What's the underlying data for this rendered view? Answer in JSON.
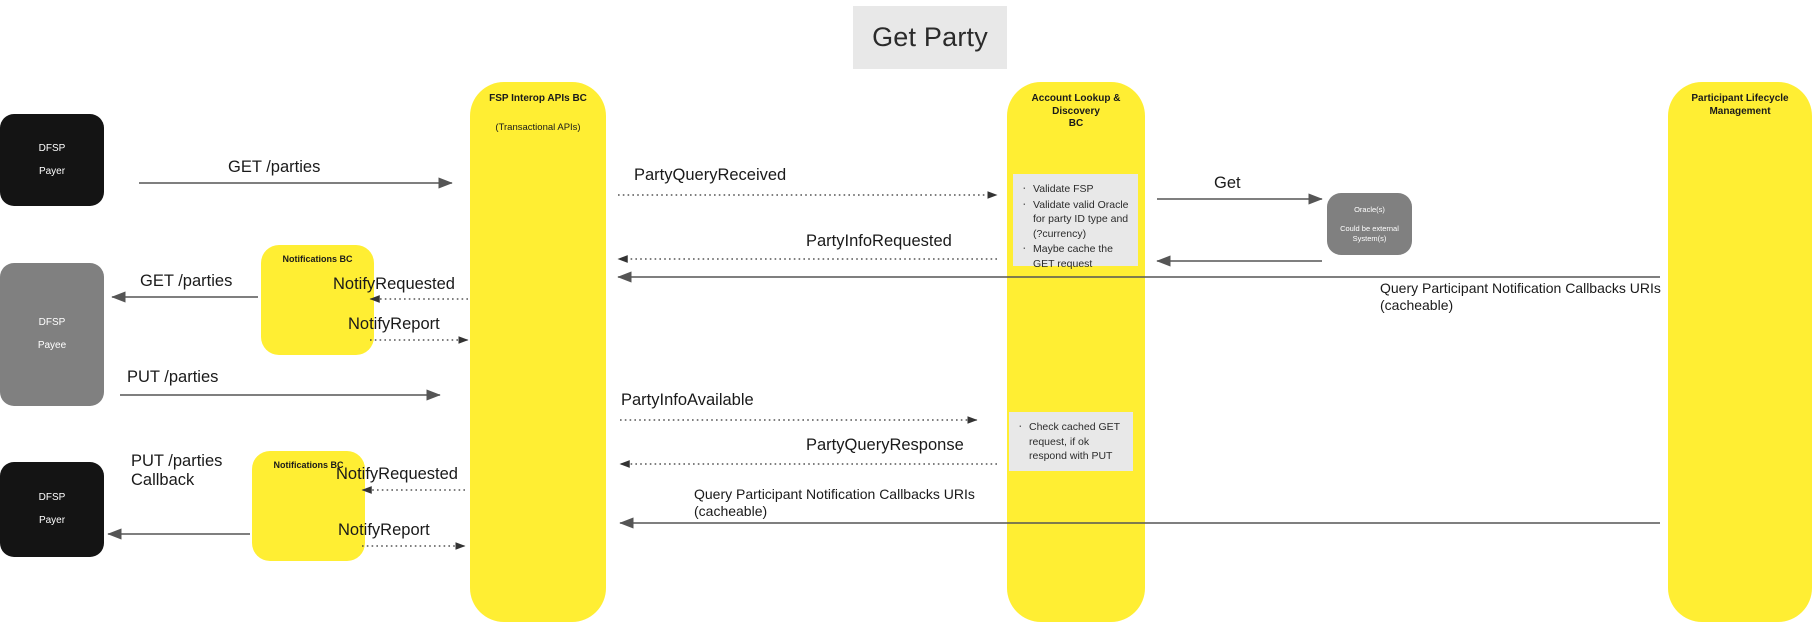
{
  "title": "Get Party",
  "colors": {
    "lifeline_yellow": "#ffee33",
    "note_gray": "#e8e8e8",
    "actor_black": "#141414",
    "actor_gray": "#808080",
    "oracle_gray": "#808080",
    "title_bg": "#e8e8e8"
  },
  "actors": [
    {
      "name": "dfsp-payer-top",
      "line1": "DFSP",
      "line2": "Payer"
    },
    {
      "name": "dfsp-payee",
      "line1": "DFSP",
      "line2": "Payee"
    },
    {
      "name": "dfsp-payer-bottom",
      "line1": "DFSP",
      "line2": "Payer"
    },
    {
      "name": "oracles",
      "line1": "Oracle(s)",
      "line2": "Could be external\nSystem(s)"
    }
  ],
  "lifelines": [
    {
      "name": "fsp-interop-apis-bc",
      "title": "FSP Interop APIs BC",
      "subtitle": "(Transactional APIs)"
    },
    {
      "name": "account-lookup-discovery-bc",
      "title": "Account Lookup & Discovery\nBC",
      "subtitle": ""
    },
    {
      "name": "participant-lifecycle-management",
      "title": "Participant Lifecycle\nManagement",
      "subtitle": ""
    }
  ],
  "notification_blocks": [
    {
      "name": "notifications-bc-upper",
      "title": "Notifications BC"
    },
    {
      "name": "notifications-bc-lower",
      "title": "Notifications BC"
    }
  ],
  "notes": [
    {
      "name": "note-validate",
      "items": [
        "Validate FSP",
        "Validate valid Oracle for party ID type and (?currency)",
        "Maybe cache the GET request"
      ]
    },
    {
      "name": "note-check-cache",
      "items": [
        "Check cached GET request, if ok respond with PUT"
      ]
    }
  ],
  "messages": [
    {
      "name": "msg-get-parties-1",
      "label": "GET /parties"
    },
    {
      "name": "msg-party-query-received",
      "label": "PartyQueryReceived"
    },
    {
      "name": "msg-get",
      "label": "Get"
    },
    {
      "name": "msg-party-info-requested",
      "label": "PartyInfoRequested"
    },
    {
      "name": "msg-get-parties-2",
      "label": "GET /parties"
    },
    {
      "name": "msg-notify-requested-1",
      "label": "NotifyRequested"
    },
    {
      "name": "msg-notify-report-1",
      "label": "NotifyReport"
    },
    {
      "name": "msg-query-callbacks-1",
      "label": "Query Participant Notification Callbacks URIs\n(cacheable)"
    },
    {
      "name": "msg-put-parties",
      "label": "PUT /parties"
    },
    {
      "name": "msg-party-info-available",
      "label": "PartyInfoAvailable"
    },
    {
      "name": "msg-party-query-response",
      "label": "PartyQueryResponse"
    },
    {
      "name": "msg-put-parties-callback",
      "label": "PUT /parties\nCallback"
    },
    {
      "name": "msg-notify-requested-2",
      "label": "NotifyRequested"
    },
    {
      "name": "msg-notify-report-2",
      "label": "NotifyReport"
    },
    {
      "name": "msg-query-callbacks-2",
      "label": "Query Participant Notification Callbacks URIs\n(cacheable)"
    }
  ]
}
